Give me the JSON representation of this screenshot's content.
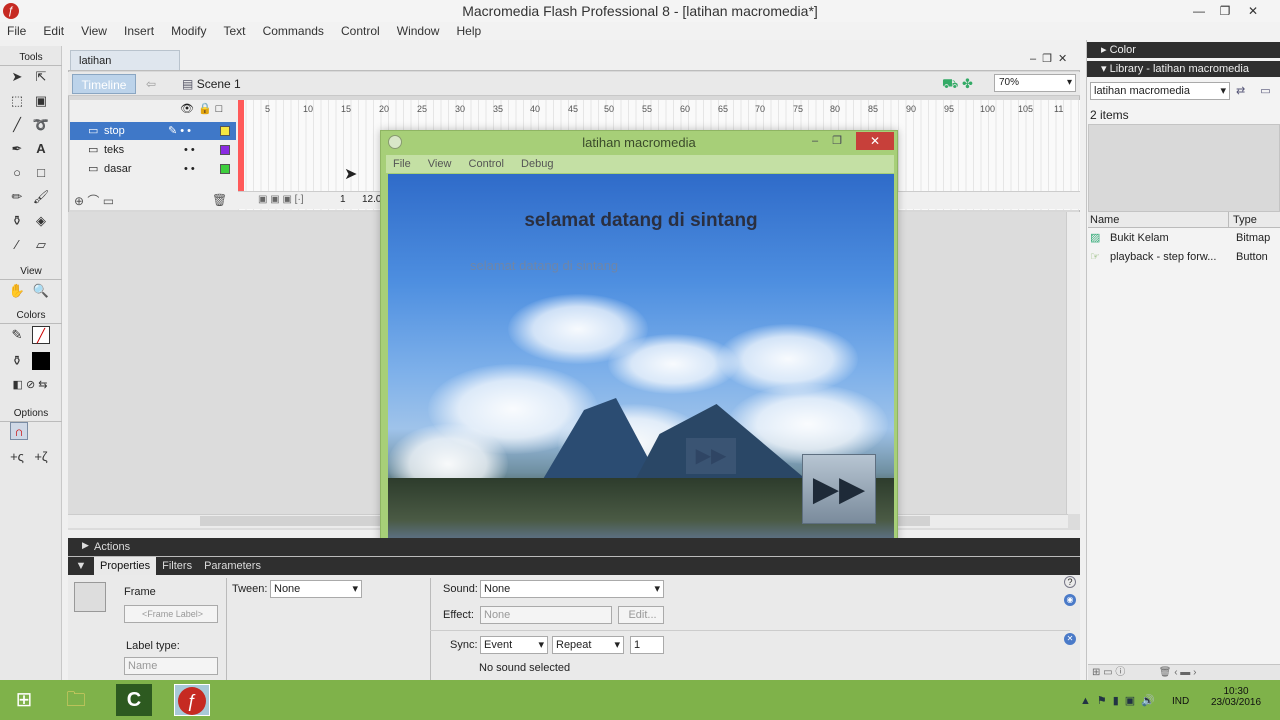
{
  "window": {
    "title": "Macromedia Flash Professional 8 - [latihan macromedia*]"
  },
  "menubar": [
    "File",
    "Edit",
    "View",
    "Insert",
    "Modify",
    "Text",
    "Commands",
    "Control",
    "Window",
    "Help"
  ],
  "toolbox": {
    "tools_label": "Tools",
    "view_label": "View",
    "colors_label": "Colors",
    "options_label": "Options"
  },
  "document": {
    "tab": "latihan macromedia*",
    "timeline_button": "Timeline",
    "scene": "Scene 1",
    "zoom": "70%"
  },
  "timeline": {
    "ruler": [
      "5",
      "10",
      "15",
      "20",
      "25",
      "30",
      "35",
      "40",
      "45",
      "50",
      "55",
      "60",
      "65",
      "70",
      "75",
      "80",
      "85",
      "90",
      "95",
      "100",
      "105",
      "11"
    ],
    "layers": [
      {
        "name": "stop",
        "color": "#f5e642"
      },
      {
        "name": "teks",
        "color": "#8a2be2"
      },
      {
        "name": "dasar",
        "color": "#3ecf3e"
      }
    ],
    "frame": "1",
    "fps": "12.0"
  },
  "popup": {
    "title": "latihan macromedia",
    "menu": [
      "File",
      "View",
      "Control",
      "Debug"
    ],
    "welcome_text": "selamat datang di sintang",
    "ghost_text": "selamat datang di sintang"
  },
  "right_panel": {
    "color_header": "Color",
    "library_header": "Library - latihan macromedia",
    "library_select": "latihan macromedia",
    "item_count": "2 items",
    "col_name": "Name",
    "col_type": "Type",
    "items": [
      {
        "name": "Bukit Kelam",
        "type": "Bitmap"
      },
      {
        "name": "playback - step forw...",
        "type": "Button"
      }
    ]
  },
  "actions_label": "Actions",
  "properties": {
    "tabs": [
      "Properties",
      "Filters",
      "Parameters"
    ],
    "frame_label": "Frame",
    "frame_label_placeholder": "<Frame Label>",
    "label_type_label": "Label type:",
    "label_type_value": "Name",
    "tween_label": "Tween:",
    "tween_value": "None",
    "sound_label": "Sound:",
    "sound_value": "None",
    "effect_label": "Effect:",
    "effect_value": "None",
    "edit_button": "Edit...",
    "sync_label": "Sync:",
    "sync_value": "Event",
    "repeat_value": "Repeat",
    "repeat_count": "1",
    "status": "No sound selected"
  },
  "taskbar": {
    "lang": "IND",
    "time": "10:30",
    "date": "23/03/2016"
  }
}
